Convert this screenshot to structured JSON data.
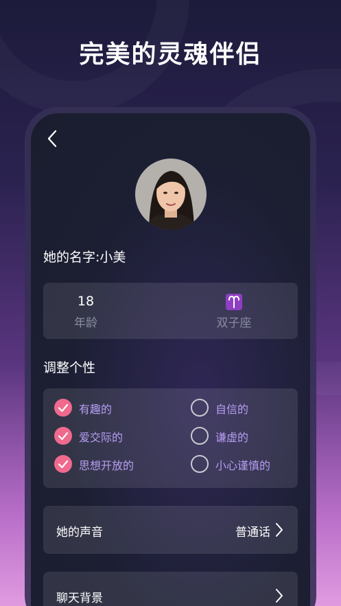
{
  "headline": "完美的灵魂伴侣",
  "profile": {
    "name_line": "她的名字:小美"
  },
  "info": {
    "age_value": "18",
    "age_label": "年龄",
    "zodiac_icon": "aries-icon",
    "zodiac_label": "双子座"
  },
  "personality": {
    "title": "调整个性",
    "traits": [
      {
        "label": "有趣的",
        "checked": true
      },
      {
        "label": "自信的",
        "checked": false
      },
      {
        "label": "爱交际的",
        "checked": true
      },
      {
        "label": "谦虚的",
        "checked": false
      },
      {
        "label": "思想开放的",
        "checked": true
      },
      {
        "label": "小心谨慎的",
        "checked": false
      }
    ]
  },
  "voice": {
    "label": "她的声音",
    "value": "普通话"
  },
  "background": {
    "label": "聊天背景"
  },
  "colors": {
    "accent_pink": "#f06a8e",
    "trait_text": "#b79df2",
    "zodiac_bg": "#8e3fc2"
  }
}
